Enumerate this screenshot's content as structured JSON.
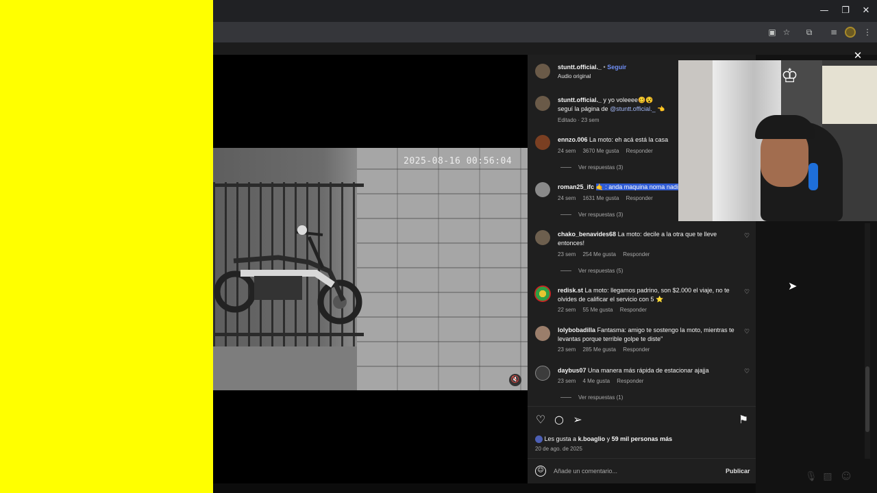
{
  "browser": {
    "window_controls": {
      "minimize": "—",
      "restore": "❐",
      "close": "✕"
    },
    "toolbar_icons": [
      "cast-icon",
      "star-icon",
      "extensions-icon",
      "media-icon",
      "profile-avatar",
      "menu-icon"
    ]
  },
  "video": {
    "timestamp_overlay": "2025-08-16 00:56:04",
    "muted": true
  },
  "post": {
    "author": "stuntt.official._",
    "follow_label": "Seguir",
    "audio_label": "Audio original",
    "caption_user": "stuntt.official._",
    "caption_text": "y yo voleeee🥴😵",
    "caption_line2_prefix": "seguí la página de",
    "caption_mention": "@stuntt.official._",
    "caption_line2_suffix": "👈",
    "caption_meta": "Editado · 23 sem",
    "likes_text_prefix": "Les gusta a",
    "likes_user": "k.boaglio",
    "likes_text_mid": "y",
    "likes_count": "59 mil personas más",
    "date": "20 de ago. de 2025",
    "comment_placeholder": "Añade un comentario...",
    "publish_label": "Publicar"
  },
  "comments": [
    {
      "user": "ennzo.006",
      "text": "La moto: eh acá está la casa",
      "age": "24 sem",
      "likes": "3670 Me gusta",
      "reply": "Responder",
      "replies": "Ver respuestas (3)"
    },
    {
      "user": "roman25_ifc",
      "text_highlight": "🤙 : anda maquina noma nadie",
      "age": "24 sem",
      "likes": "1631 Me gusta",
      "reply": "Responder",
      "replies": "Ver respuestas (3)"
    },
    {
      "user": "chako_benavides68",
      "text": "La moto: decile a la otra que te lleve entonces!",
      "age": "23 sem",
      "likes": "254 Me gusta",
      "reply": "Responder",
      "replies": "Ver respuestas (5)"
    },
    {
      "user": "redisk.st",
      "text": "La moto: llegamos padrino, son $2.000 el viaje, no te olvides de calificar el servicio con 5 ⭐",
      "age": "22 sem",
      "likes": "55 Me gusta",
      "reply": "Responder"
    },
    {
      "user": "lolybobadilla",
      "text": "Fantasma: amigo te sostengo la moto, mientras te levantas porque terrible golpe te diste\"",
      "age": "23 sem",
      "likes": "285 Me gusta",
      "reply": "Responder"
    },
    {
      "user": "daybus07",
      "text": "Una manera más rápida de estacionar ajajja",
      "age": "23 sem",
      "likes": "4 Me gusta",
      "reply": "Responder",
      "replies": "Ver respuestas (1)"
    }
  ],
  "colors": {
    "left_fill": "#ffff00",
    "panel_bg": "#1f1f1f",
    "highlight": "#2f5bd3",
    "follow": "#6f8ef5"
  }
}
